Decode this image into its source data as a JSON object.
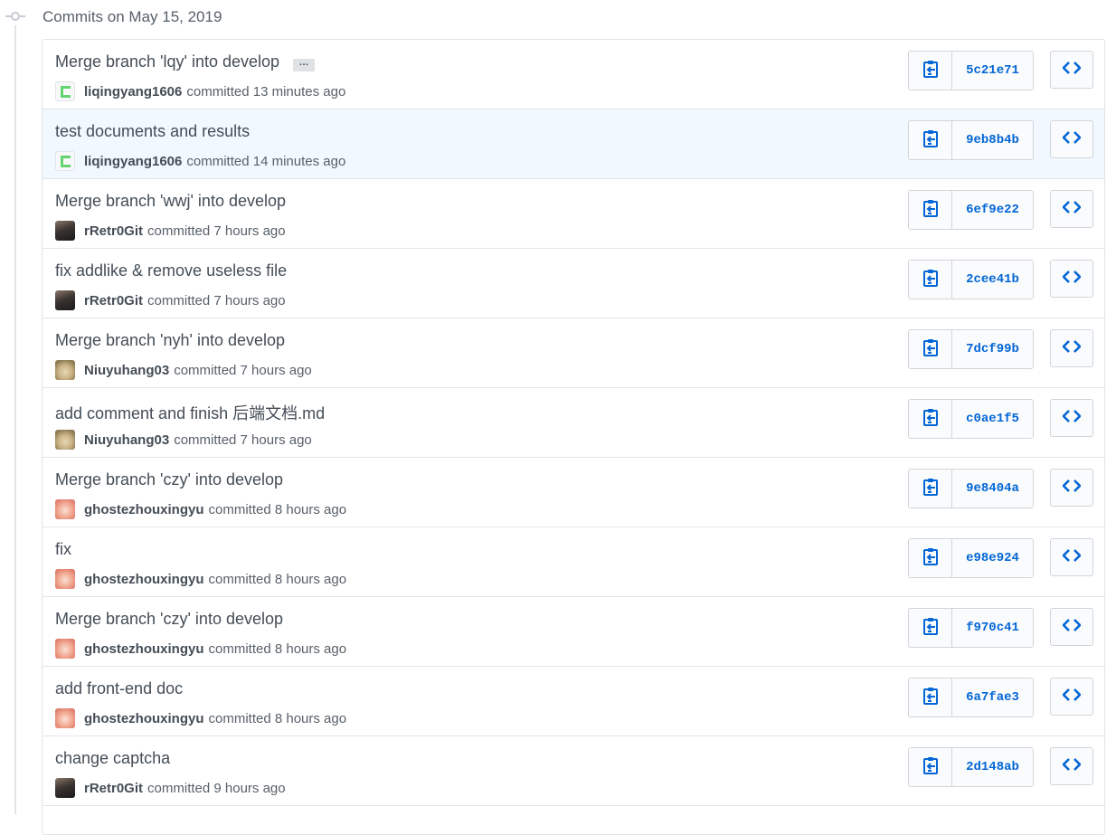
{
  "header": {
    "title": "Commits on May 15, 2019"
  },
  "commits": [
    {
      "message": "Merge branch 'lqy' into develop",
      "has_ellipsis": true,
      "ellipsis_label": "…",
      "author": "liqingyang1606",
      "time_text": "committed 13 minutes ago",
      "sha": "5c21e71",
      "avatar": "green"
    },
    {
      "message": "test documents and results",
      "author": "liqingyang1606",
      "time_text": "committed 14 minutes ago",
      "sha": "9eb8b4b",
      "avatar": "green",
      "highlight": true
    },
    {
      "message": "Merge branch 'wwj' into develop",
      "author": "rRetr0Git",
      "time_text": "committed 7 hours ago",
      "sha": "6ef9e22",
      "avatar": "dark"
    },
    {
      "message": "fix addlike & remove useless file",
      "author": "rRetr0Git",
      "time_text": "committed 7 hours ago",
      "sha": "2cee41b",
      "avatar": "dark"
    },
    {
      "message": "Merge branch 'nyh' into develop",
      "author": "Niuyuhang03",
      "time_text": "committed 7 hours ago",
      "sha": "7dcf99b",
      "avatar": "dog"
    },
    {
      "message": "add comment and finish 后端文档.md",
      "author": "Niuyuhang03",
      "time_text": "committed 7 hours ago",
      "sha": "c0ae1f5",
      "avatar": "dog"
    },
    {
      "message": "Merge branch 'czy' into develop",
      "author": "ghostezhouxingyu",
      "time_text": "committed 8 hours ago",
      "sha": "9e8404a",
      "avatar": "anime"
    },
    {
      "message": "fix",
      "author": "ghostezhouxingyu",
      "time_text": "committed 8 hours ago",
      "sha": "e98e924",
      "avatar": "anime"
    },
    {
      "message": "Merge branch 'czy' into develop",
      "author": "ghostezhouxingyu",
      "time_text": "committed 8 hours ago",
      "sha": "f970c41",
      "avatar": "anime"
    },
    {
      "message": "add front-end doc",
      "author": "ghostezhouxingyu",
      "time_text": "committed 8 hours ago",
      "sha": "6a7fae3",
      "avatar": "anime"
    },
    {
      "message": "change captcha",
      "author": "rRetr0Git",
      "time_text": "committed 9 hours ago",
      "sha": "2d148ab",
      "avatar": "dark"
    }
  ],
  "icons": {
    "commit_node": "git-commit-icon",
    "copy": "clipboard-icon",
    "browse": "code-icon"
  },
  "colors": {
    "link": "#0366d6",
    "highlight_row": "#f1f8ff",
    "border": "#e1e4e8"
  }
}
